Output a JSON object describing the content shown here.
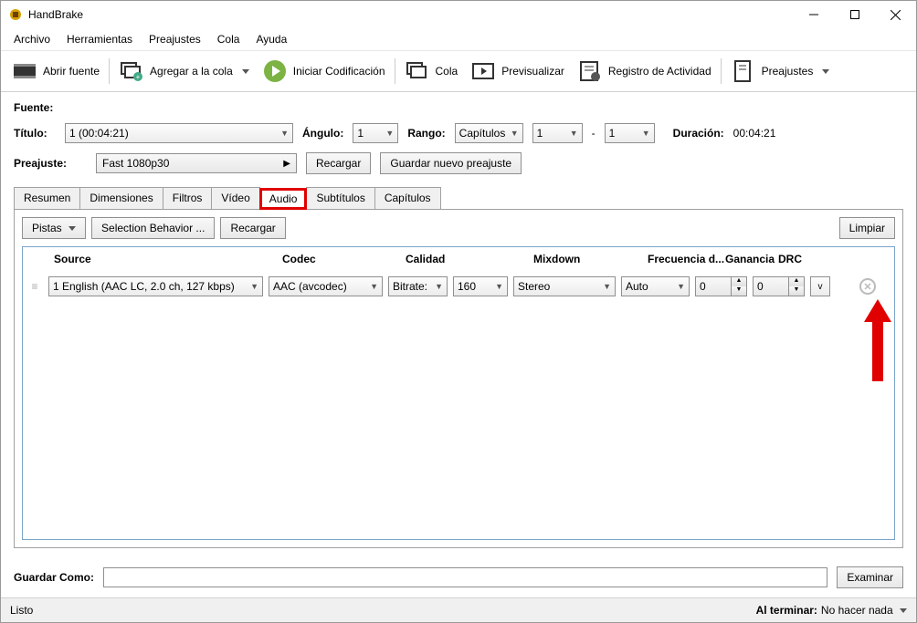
{
  "app": {
    "title": "HandBrake"
  },
  "menu": {
    "file": "Archivo",
    "tools": "Herramientas",
    "presets": "Preajustes",
    "queue": "Cola",
    "help": "Ayuda"
  },
  "toolbar": {
    "open_source": "Abrir fuente",
    "add_queue": "Agregar a la cola",
    "start_encode": "Iniciar Codificación",
    "queue": "Cola",
    "preview": "Previsualizar",
    "activity_log": "Registro de Actividad",
    "presets": "Preajustes"
  },
  "source": {
    "label": "Fuente:",
    "title_label": "Título:",
    "title_value": "1  (00:04:21)",
    "angle_label": "Ángulo:",
    "angle_value": "1",
    "range_label": "Rango:",
    "range_value": "Capítulos",
    "range_from": "1",
    "range_sep": "-",
    "range_to": "1",
    "duration_label": "Duración:",
    "duration_value": "00:04:21"
  },
  "preset": {
    "label": "Preajuste:",
    "value": "Fast 1080p30",
    "reload": "Recargar",
    "save_new": "Guardar nuevo preajuste"
  },
  "tabs": {
    "summary": "Resumen",
    "dimensions": "Dimensiones",
    "filters": "Filtros",
    "video": "Vídeo",
    "audio": "Audio",
    "subtitles": "Subtítulos",
    "chapters": "Capítulos"
  },
  "audio": {
    "tracks_btn": "Pistas",
    "selection_behavior": "Selection Behavior ...",
    "reload": "Recargar",
    "clear": "Limpiar",
    "headers": {
      "source": "Source",
      "codec": "Codec",
      "quality": "Calidad",
      "mixdown": "Mixdown",
      "samplerate": "Frecuencia d...",
      "gain": "Ganancia",
      "drc": "DRC"
    },
    "track": {
      "source": "1 English (AAC LC, 2.0 ch, 127 kbps)",
      "codec": "AAC (avcodec)",
      "quality_mode": "Bitrate:",
      "bitrate": "160",
      "mixdown": "Stereo",
      "samplerate": "Auto",
      "gain": "0",
      "drc": "0",
      "expand": "v"
    }
  },
  "save": {
    "label": "Guardar Como:",
    "value": "",
    "browse": "Examinar"
  },
  "status": {
    "ready": "Listo",
    "when_done_label": "Al terminar:",
    "when_done_value": "No hacer nada"
  }
}
